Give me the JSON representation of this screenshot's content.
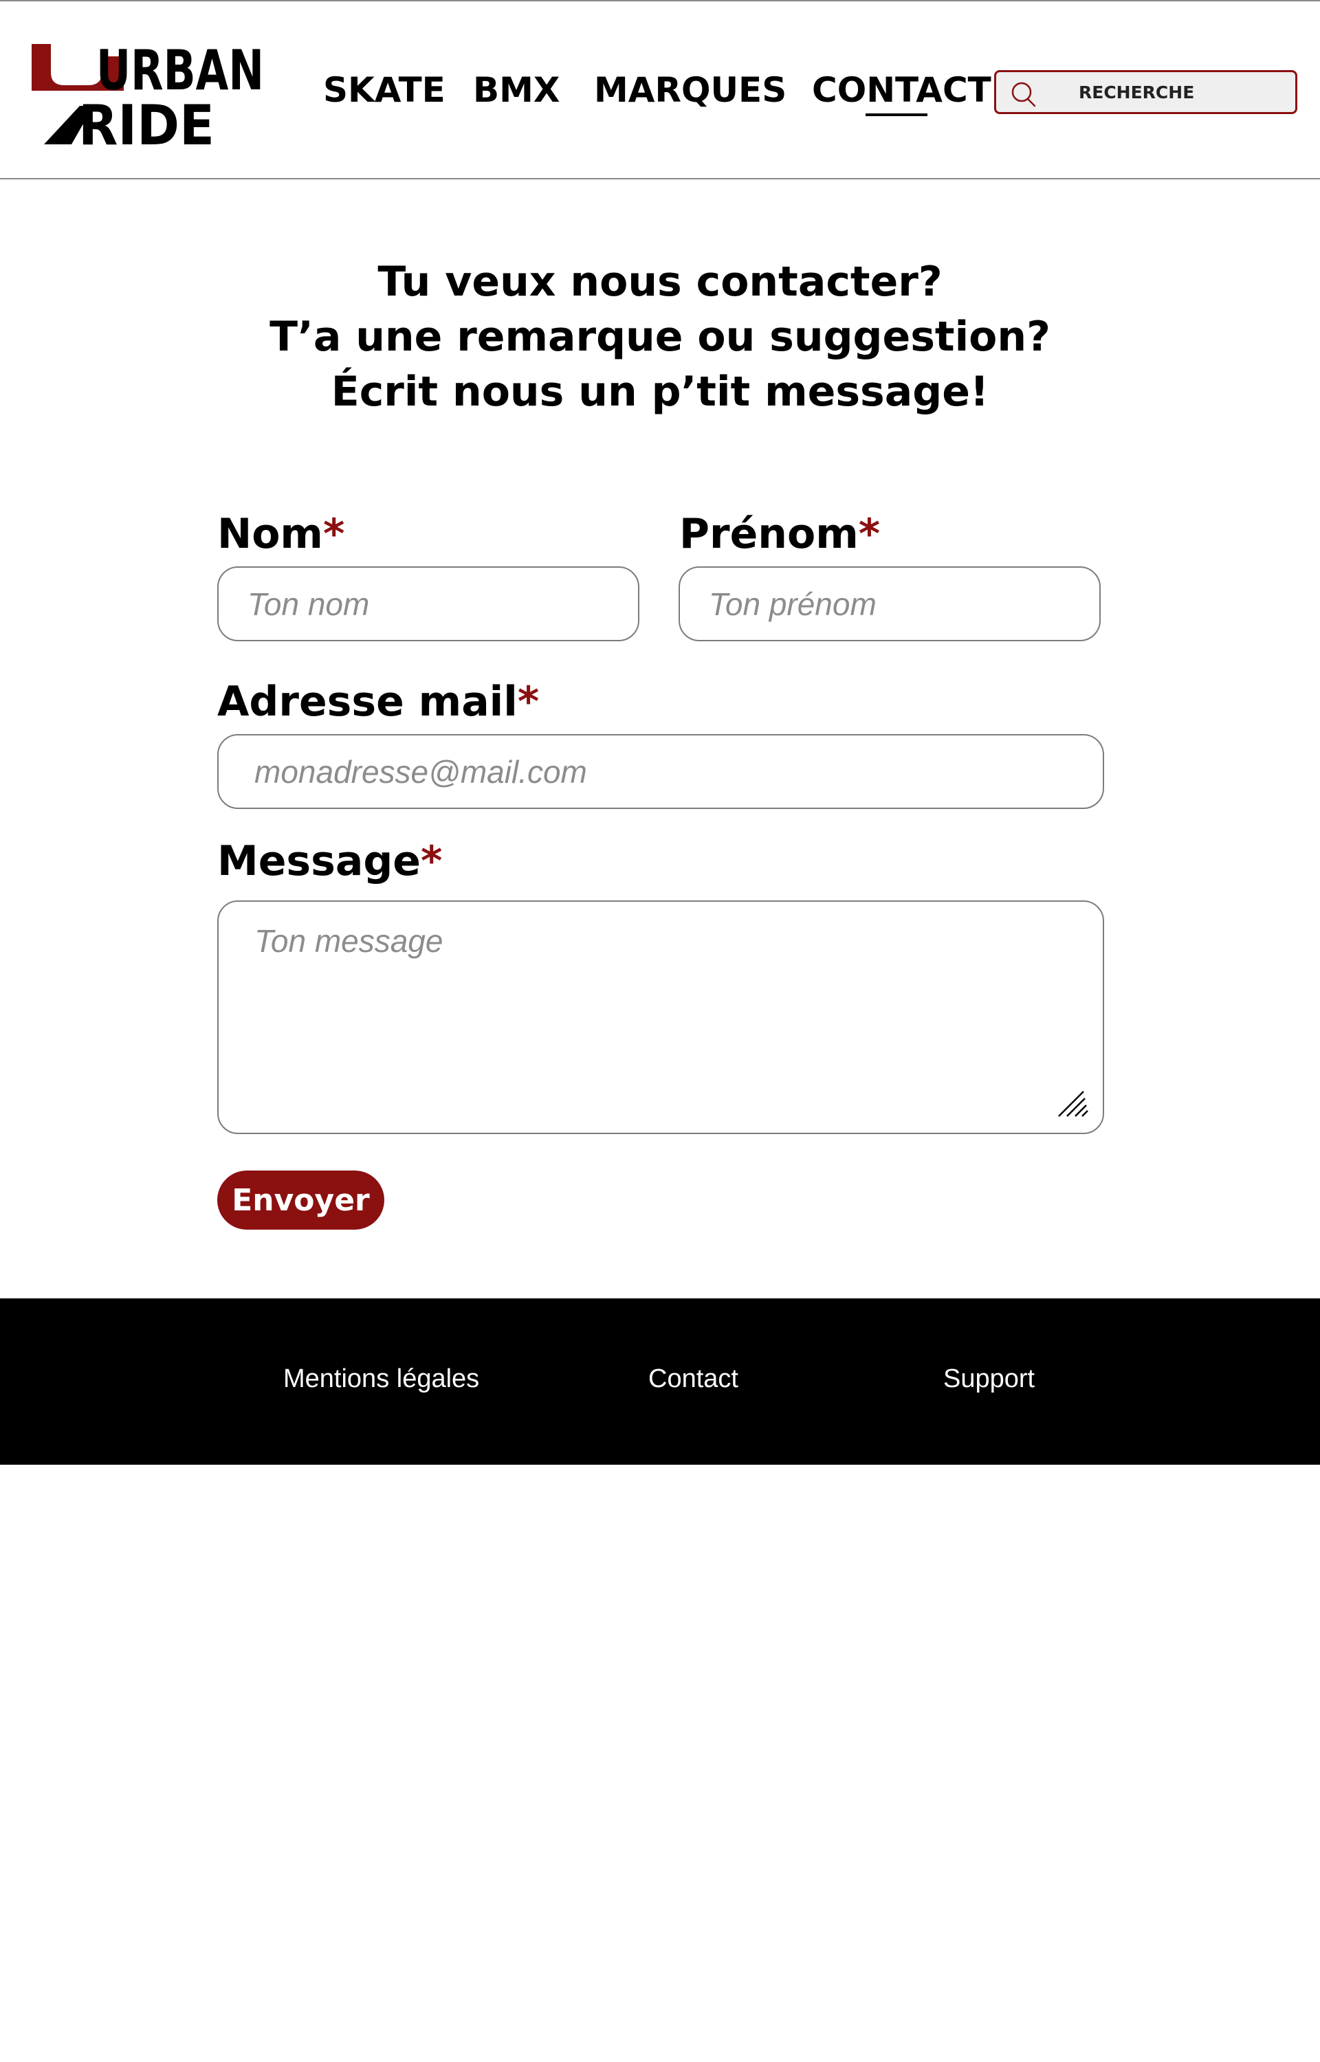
{
  "brand": {
    "logo_line1": "URBAN",
    "logo_line2": "RIDE",
    "accent_color": "#8b1010"
  },
  "nav": {
    "items": [
      {
        "label": "SKATE"
      },
      {
        "label": "BMX"
      },
      {
        "label": "MARQUES"
      },
      {
        "label": "CONTACT",
        "active": true
      }
    ]
  },
  "search": {
    "placeholder": "RECHERCHE",
    "icon": "search-icon"
  },
  "headline": {
    "line1": "Tu veux nous contacter?",
    "line2": "T’a une remarque ou suggestion?",
    "line3": "Écrit nous un p’tit message!"
  },
  "form": {
    "required_mark": "*",
    "nom": {
      "label": "Nom",
      "placeholder": "Ton nom"
    },
    "prenom": {
      "label": "Prénom",
      "placeholder": "Ton prénom"
    },
    "mail": {
      "label": "Adresse mail",
      "placeholder": "monadresse@mail.com"
    },
    "message": {
      "label": "Message",
      "placeholder": "Ton message"
    },
    "submit_label": "Envoyer"
  },
  "footer": {
    "links": [
      {
        "label": "Mentions légales"
      },
      {
        "label": "Contact"
      },
      {
        "label": "Support"
      }
    ]
  }
}
